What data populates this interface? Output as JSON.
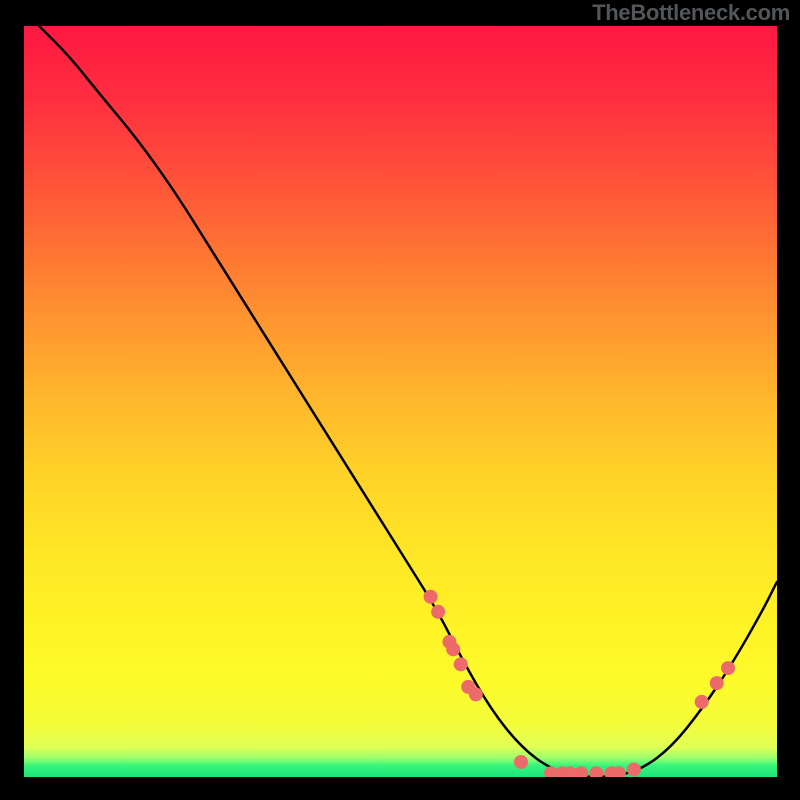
{
  "attribution": "TheBottleneck.com",
  "chart_data": {
    "type": "line",
    "title": "",
    "xlabel": "",
    "ylabel": "",
    "xlim": [
      0,
      100
    ],
    "ylim": [
      0,
      100
    ],
    "series": [
      {
        "name": "curve",
        "x": [
          2,
          6,
          10,
          15,
          20,
          25,
          30,
          35,
          40,
          45,
          50,
          55,
          58,
          62,
          66,
          70,
          74,
          78,
          82,
          86,
          90,
          94,
          98,
          100
        ],
        "y": [
          100,
          96,
          91,
          85,
          78,
          70,
          62,
          54,
          46,
          38,
          30,
          22,
          16,
          9,
          4,
          1,
          0,
          0,
          1,
          4,
          9,
          15,
          22,
          26
        ]
      }
    ],
    "markers": [
      {
        "x": 54,
        "y": 24
      },
      {
        "x": 55,
        "y": 22
      },
      {
        "x": 56.5,
        "y": 18
      },
      {
        "x": 57,
        "y": 17
      },
      {
        "x": 58,
        "y": 15
      },
      {
        "x": 59,
        "y": 12
      },
      {
        "x": 60,
        "y": 11
      },
      {
        "x": 66,
        "y": 2
      },
      {
        "x": 70,
        "y": 0.5
      },
      {
        "x": 71.5,
        "y": 0.5
      },
      {
        "x": 72.5,
        "y": 0.5
      },
      {
        "x": 74,
        "y": 0.5
      },
      {
        "x": 76,
        "y": 0.5
      },
      {
        "x": 78,
        "y": 0.5
      },
      {
        "x": 79,
        "y": 0.5
      },
      {
        "x": 81,
        "y": 1
      },
      {
        "x": 90,
        "y": 10
      },
      {
        "x": 92,
        "y": 12.5
      },
      {
        "x": 93.5,
        "y": 14.5
      }
    ],
    "marker_color": "#ed6a6a",
    "curve_color": "#000000",
    "curve_width": 2.5
  }
}
